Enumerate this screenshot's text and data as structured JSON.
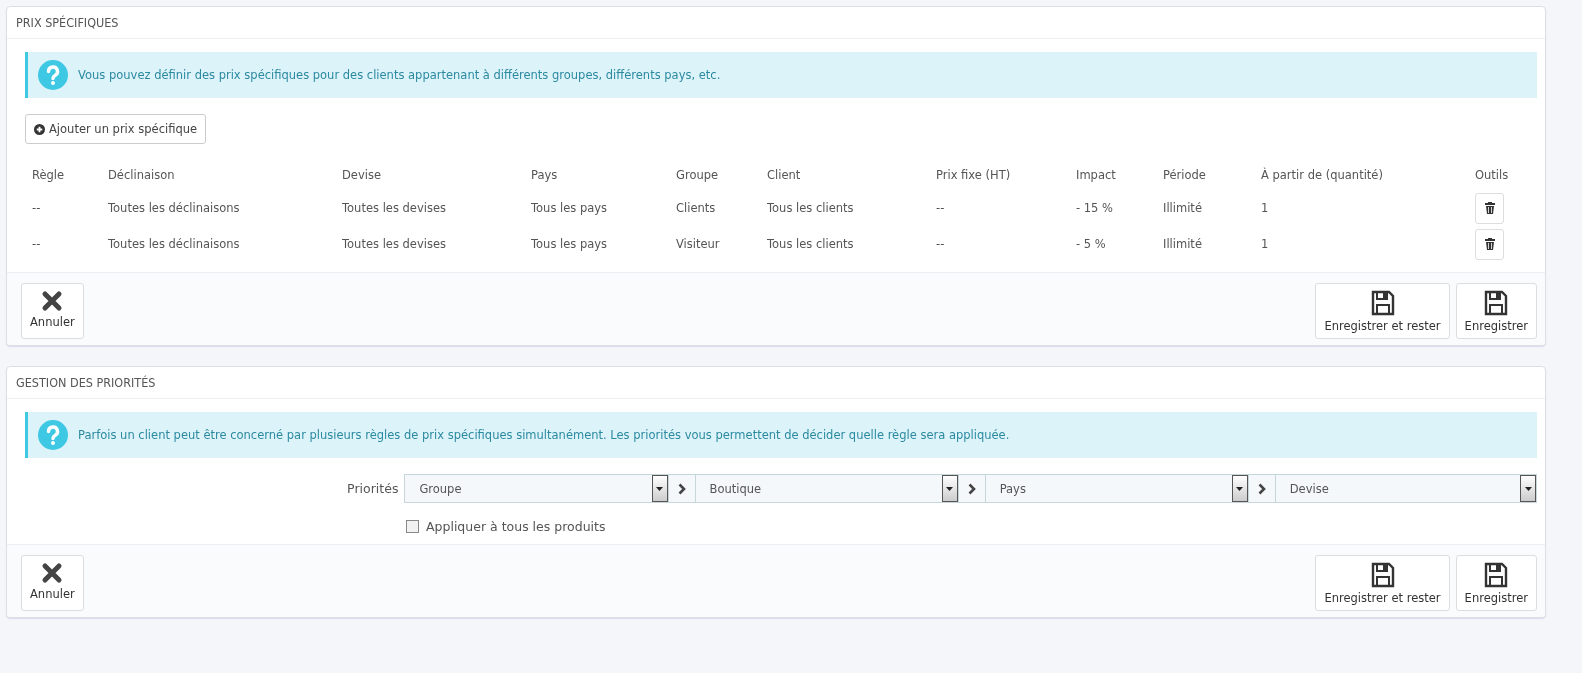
{
  "specific_prices": {
    "title": "PRIX SPÉCIFIQUES",
    "info": "Vous pouvez définir des prix spécifiques pour des clients appartenant à différents groupes, différents pays, etc.",
    "add_button": "Ajouter un prix spécifique",
    "table": {
      "columns": [
        "Règle",
        "Déclinaison",
        "Devise",
        "Pays",
        "Groupe",
        "Client",
        "Prix fixe (HT)",
        "Impact",
        "Période",
        "À partir de (quantité)",
        "Outils"
      ],
      "rows": [
        [
          "--",
          "Toutes les déclinaisons",
          "Toutes les devises",
          "Tous les pays",
          "Clients",
          "Tous les clients",
          "--",
          "- 15 %",
          "Illimité",
          "1"
        ],
        [
          "--",
          "Toutes les déclinaisons",
          "Toutes les devises",
          "Tous les pays",
          "Visiteur",
          "Tous les clients",
          "--",
          "- 5 %",
          "Illimité",
          "1"
        ]
      ]
    },
    "footer": {
      "cancel": "Annuler",
      "save_stay": "Enregistrer et rester",
      "save": "Enregistrer"
    }
  },
  "priorities": {
    "title": "GESTION DES PRIORITÉS",
    "info": "Parfois un client peut être concerné par plusieurs règles de prix spécifiques simultanément. Les priorités vous permettent de décider quelle règle sera appliquée.",
    "label": "Priorités",
    "selects": [
      "Groupe",
      "Boutique",
      "Pays",
      "Devise"
    ],
    "apply_all": {
      "label": "Appliquer à tous les produits",
      "checked": false
    },
    "footer": {
      "cancel": "Annuler",
      "save_stay": "Enregistrer et rester",
      "save": "Enregistrer"
    }
  }
}
